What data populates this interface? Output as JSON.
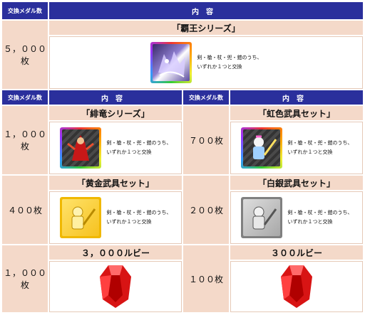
{
  "header_top": {
    "qty_label": "交換メダル数",
    "content_label": "内容"
  },
  "header_row": {
    "qty_label_left": "交換メダル数",
    "content_label_left": "内容",
    "qty_label_right": "交換メダル数",
    "content_label_right": "内容"
  },
  "desc": {
    "line1": "剣・槍・杖・兜・鎧のうち、",
    "line2": "いずれか１つと交換"
  },
  "items": {
    "haou": {
      "qty": "５，０００枚",
      "title": "「覇王シリーズ」"
    },
    "hiryu": {
      "qty": "１，０００枚",
      "title": "「緋竜シリーズ」"
    },
    "niji": {
      "qty": "７００枚",
      "title": "「虹色武具セット」"
    },
    "ougon": {
      "qty": "４００枚",
      "title": "「黄金武具セット」"
    },
    "hakugin": {
      "qty": "２００枚",
      "title": "「白銀武具セット」"
    },
    "ruby3000": {
      "qty": "１，０００枚",
      "title": "３，０００ルビー"
    },
    "ruby300": {
      "qty": "１００枚",
      "title": "３００ルビー"
    }
  },
  "icons": {
    "item_icon": "monster-card-icon",
    "ruby_icon": "ruby-gem-icon"
  },
  "colors": {
    "header_bg": "#2a2f9c",
    "cell_bg": "#f4d9c9",
    "ruby": "#e01818"
  }
}
